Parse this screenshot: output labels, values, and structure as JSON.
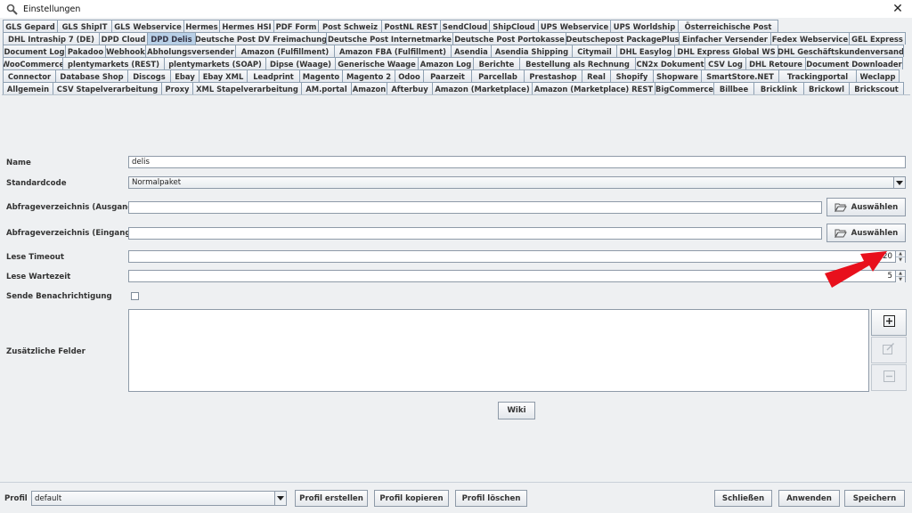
{
  "window": {
    "title": "Einstellungen"
  },
  "tabs": {
    "row1": [
      "GLS Gepard",
      "GLS ShipIT",
      "GLS Webservice",
      "Hermes",
      "Hermes HSI",
      "PDF Form",
      "Post Schweiz",
      "PostNL REST",
      "SendCloud",
      "ShipCloud",
      "UPS Webservice",
      "UPS Worldship",
      "Österreichische Post"
    ],
    "row2": [
      "DHL Intraship 7 (DE)",
      "DPD Cloud",
      "DPD Delis",
      "Deutsche Post DV Freimachung",
      "Deutsche Post Internetmarke",
      "Deutsche Post Portokasse",
      "Deutschepost PackagePlus",
      "Einfacher Versender",
      "Fedex Webservice",
      "GEL Express"
    ],
    "row3": [
      "Document Log",
      "Pakadoo",
      "Webhook",
      "Abholungsversender",
      "Amazon (Fulfillment)",
      "Amazon FBA (Fulfillment)",
      "Asendia",
      "Asendia Shipping",
      "Citymail",
      "DHL Easylog",
      "DHL Express Global WS",
      "DHL Geschäftskundenversand"
    ],
    "row4": [
      "WooCommerce",
      "plentymarkets (REST)",
      "plentymarkets (SOAP)",
      "Dipse (Waage)",
      "Generische Waage",
      "Amazon Log",
      "Berichte",
      "Bestellung als Rechnung",
      "CN2x Dokument",
      "CSV Log",
      "DHL Retoure",
      "Document Downloader"
    ],
    "row5": [
      "Connector",
      "Database Shop",
      "Discogs",
      "Ebay",
      "Ebay XML",
      "Leadprint",
      "Magento",
      "Magento 2",
      "Odoo",
      "Paarzeit",
      "Parcellab",
      "Prestashop",
      "Real",
      "Shopify",
      "Shopware",
      "SmartStore.NET",
      "Trackingportal",
      "Weclapp"
    ],
    "row6": [
      "Allgemein",
      "CSV Stapelverarbeitung",
      "Proxy",
      "XML Stapelverarbeitung",
      "AM.portal",
      "Amazon",
      "Afterbuy",
      "Amazon (Marketplace)",
      "Amazon (Marketplace) REST",
      "BigCommerce",
      "Billbee",
      "Bricklink",
      "Brickowl",
      "Brickscout"
    ],
    "active": "DPD Delis"
  },
  "form": {
    "name_label": "Name",
    "name_value": "delis",
    "standardcode_label": "Standardcode",
    "standardcode_value": "Normalpaket",
    "abfrage_ausgang_label": "Abfrageverzeichnis (Ausgang) *",
    "abfrage_ausgang_value": "",
    "abfrage_eingang_label": "Abfrageverzeichnis (Eingang) *",
    "abfrage_eingang_value": "",
    "auswaehlen_label": "Auswählen",
    "lese_timeout_label": "Lese Timeout",
    "lese_timeout_value": "120",
    "lese_wartezeit_label": "Lese Wartezeit",
    "lese_wartezeit_value": "5",
    "sende_benachrichtigung_label": "Sende Benachrichtigung",
    "sende_benachrichtigung_checked": false,
    "zusaetzliche_felder_label": "Zusätzliche Felder",
    "wiki_label": "Wiki"
  },
  "bottom": {
    "profil_label": "Profil",
    "profil_value": "default",
    "profil_erstellen": "Profil erstellen",
    "profil_kopieren": "Profil kopieren",
    "profil_loeschen": "Profil löschen",
    "schliessen": "Schließen",
    "anwenden": "Anwenden",
    "speichern": "Speichern"
  },
  "colors": {
    "active_tab": "#b8cfe6",
    "arrow": "#e8101c"
  },
  "icons": [
    "app-icon",
    "close-icon",
    "folder-open-icon",
    "plus-icon",
    "edit-icon",
    "minus-icon",
    "dropdown-arrow-icon"
  ]
}
